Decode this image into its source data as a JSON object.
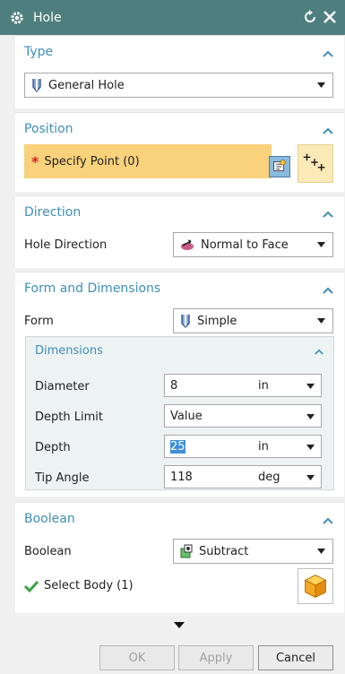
{
  "window": {
    "title": "Hole"
  },
  "type_section": {
    "header": "Type",
    "selected": "General Hole"
  },
  "position_section": {
    "header": "Position",
    "specify_point": "Specify Point (0)"
  },
  "direction_section": {
    "header": "Direction",
    "label": "Hole Direction",
    "selected": "Normal to Face"
  },
  "form_section": {
    "header": "Form and Dimensions",
    "form_label": "Form",
    "form_selected": "Simple",
    "dimensions": {
      "header": "Dimensions",
      "rows": [
        {
          "label": "Diameter",
          "value": "8",
          "unit": "in"
        },
        {
          "label": "Depth Limit",
          "value": "Value",
          "unit": ""
        },
        {
          "label": "Depth",
          "value": "25",
          "unit": "in"
        },
        {
          "label": "Tip Angle",
          "value": "118",
          "unit": "deg"
        }
      ]
    }
  },
  "boolean_section": {
    "header": "Boolean",
    "label": "Boolean",
    "selected": "Subtract",
    "select_body": "Select Body (1)"
  },
  "buttons": {
    "ok": "OK",
    "apply": "Apply",
    "cancel": "Cancel"
  },
  "colors": {
    "titlebar": "#4e7f7e",
    "section_header": "#3e8fb7",
    "required_highlight": "#f9d27b"
  },
  "icons": {
    "window": "gear-icon",
    "reset": "reset-icon",
    "close": "close-icon",
    "collapse": "chevron-up-icon",
    "type": "hole-icon",
    "point": "point-dialog-icon",
    "point_constructor": "point-constructor-icon",
    "direction": "normal-to-face-icon",
    "form": "simple-hole-icon",
    "boolean": "subtract-icon",
    "status": "check-icon",
    "body": "body-cube-icon",
    "more": "expand-more-icon"
  }
}
